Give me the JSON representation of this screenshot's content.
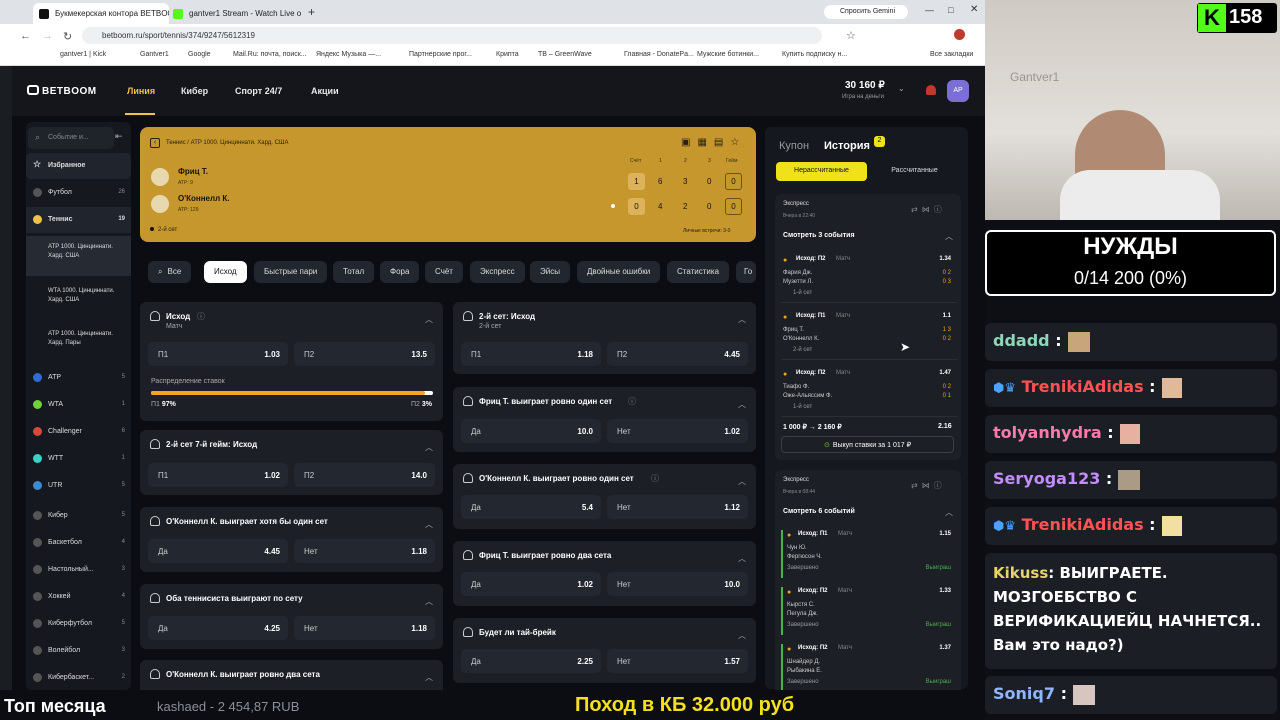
{
  "tabs": [
    {
      "label": "Букмекерская контора BETBOO"
    },
    {
      "label": "gantver1 Stream - Watch Live o"
    }
  ],
  "gemini": "Спросить Gemini",
  "url": "betboom.ru/sport/tennis/374/9247/5612319",
  "bookmarks": [
    "gantver1 | Kick",
    "Gantver1",
    "Google",
    "Mail.Ru: почта, поиск...",
    "Яндекс Музыка —...",
    "Партнерские прог...",
    "Крипта",
    "TB – GreenWave",
    "Главная - DonatePa...",
    "Мужские ботинки...",
    "Купить подписку н...",
    "Все закладки"
  ],
  "header": {
    "logo": "BETBOOM",
    "nav": [
      "Линия",
      "Кибер",
      "Спорт 24/7",
      "Акции"
    ],
    "balance": "30 160 ₽",
    "balance_sub": "Игра на деньги",
    "avatar": "АР"
  },
  "sidebar": {
    "search": "Событие и...",
    "items": [
      {
        "label": "Избранное",
        "count": ""
      },
      {
        "label": "Футбол",
        "count": "26"
      },
      {
        "label": "Теннис",
        "count": "19"
      },
      {
        "label": "ATP 1000. Цинциннати. Хард. США",
        "count": ""
      },
      {
        "label": "WTA 1000. Цинциннати. Хард. США",
        "count": ""
      },
      {
        "label": "ATP 1000. Цинциннати. Хард. Пары",
        "count": ""
      },
      {
        "label": "ATP",
        "count": "5"
      },
      {
        "label": "WTA",
        "count": "1"
      },
      {
        "label": "Challenger",
        "count": "6"
      },
      {
        "label": "WTT",
        "count": "1"
      },
      {
        "label": "UTR",
        "count": "5"
      },
      {
        "label": "Кибер",
        "count": "5"
      },
      {
        "label": "Баскетбол",
        "count": "4"
      },
      {
        "label": "Настольный...",
        "count": "3"
      },
      {
        "label": "Хоккей",
        "count": "4"
      },
      {
        "label": "Киберфутбол",
        "count": "5"
      },
      {
        "label": "Волейбол",
        "count": "3"
      },
      {
        "label": "Кибербаскет...",
        "count": "2"
      }
    ]
  },
  "match": {
    "breadcrumb": "Теннис / ATP 1000. Цинциннати. Хард. США",
    "score_headers": [
      "Счёт",
      "1",
      "2",
      "3",
      "Гейм"
    ],
    "players": [
      {
        "name": "Фриц Т.",
        "rank": "ATP: 9",
        "scores": [
          "1",
          "6",
          "3",
          "0",
          "0"
        ]
      },
      {
        "name": "О'Коннелл К.",
        "rank": "ATP: 129",
        "scores": [
          "0",
          "4",
          "2",
          "0",
          "0"
        ]
      }
    ],
    "status": "2-й сет",
    "h2h": "Личные встречи: 3-0"
  },
  "filters": [
    "Все",
    "Исход",
    "Быстрые пари",
    "Тотал",
    "Фора",
    "Счёт",
    "Экспресс",
    "Эйсы",
    "Двойные ошибки",
    "Статистика",
    "Го"
  ],
  "markets_left": [
    {
      "title": "Исход",
      "sub": "Матч",
      "odds": [
        [
          "П1",
          "1.03"
        ],
        [
          "П2",
          "13.5"
        ]
      ],
      "dist_label": "Распределение ставок",
      "dist": [
        {
          "l": "П1",
          "v": "97%"
        },
        {
          "l": "П2",
          "v": "3%"
        }
      ],
      "dist_fraction": 0.97
    },
    {
      "title": "2-й сет 7-й гейм: Исход",
      "sub": "",
      "odds": [
        [
          "П1",
          "1.02"
        ],
        [
          "П2",
          "14.0"
        ]
      ]
    },
    {
      "title": "О'Коннелл К. выиграет хотя бы один сет",
      "sub": "",
      "odds": [
        [
          "Да",
          "4.45"
        ],
        [
          "Нет",
          "1.18"
        ]
      ]
    },
    {
      "title": "Оба теннисиста выиграют по сету",
      "sub": "",
      "odds": [
        [
          "Да",
          "4.25"
        ],
        [
          "Нет",
          "1.18"
        ]
      ]
    },
    {
      "title": "О'Коннелл К. выиграет ровно два сета",
      "sub": "",
      "odds": []
    }
  ],
  "markets_right": [
    {
      "title": "2-й сет: Исход",
      "sub": "2-й сет",
      "odds": [
        [
          "П1",
          "1.18"
        ],
        [
          "П2",
          "4.45"
        ]
      ]
    },
    {
      "title": "Фриц Т. выиграет ровно один сет",
      "sub": "",
      "odds": [
        [
          "Да",
          "10.0"
        ],
        [
          "Нет",
          "1.02"
        ]
      ]
    },
    {
      "title": "О'Коннелл К. выиграет ровно один сет",
      "sub": "",
      "odds": [
        [
          "Да",
          "5.4"
        ],
        [
          "Нет",
          "1.12"
        ]
      ]
    },
    {
      "title": "Фриц Т. выиграет ровно два сета",
      "sub": "",
      "odds": [
        [
          "Да",
          "1.02"
        ],
        [
          "Нет",
          "10.0"
        ]
      ]
    },
    {
      "title": "Будет ли тай-брейк",
      "sub": "",
      "odds": [
        [
          "Да",
          "2.25"
        ],
        [
          "Нет",
          "1.57"
        ]
      ]
    }
  ],
  "betslip": {
    "tabs": [
      "Купон",
      "История"
    ],
    "history_count": "2",
    "subtabs": [
      "Нерассчитанные",
      "Рассчитанные"
    ],
    "express1": {
      "label": "Экспресс",
      "time": "Вчера в 22:40",
      "events_label": "Смотреть 3 события",
      "bets": [
        {
          "market": "Исход: П2",
          "kind": "Матч",
          "odd": "1.34",
          "p1": "Фария Дж.",
          "p2": "Музетти Л.",
          "status": "1-й сет",
          "s1": "0 2",
          "s2": "0 3"
        },
        {
          "market": "Исход: П1",
          "kind": "Матч",
          "odd": "1.1",
          "p1": "Фриц Т.",
          "p2": "О'Коннелл К.",
          "status": "2-й сет",
          "s1": "1 3",
          "s2": "0 2"
        },
        {
          "market": "Исход: П2",
          "kind": "Матч",
          "odd": "1.47",
          "p1": "Тиафо Ф.",
          "p2": "Оже-Альяссим Ф.",
          "status": "1-й сет",
          "s1": "0 2",
          "s2": "0 1"
        }
      ],
      "stake": "1 000 ₽ → 2 160 ₽",
      "total_odd": "2.16",
      "cashout": "Выкуп ставки за 1 017 ₽"
    },
    "express2": {
      "label": "Экспресс",
      "time": "Вчера в 08:44",
      "events_label": "Смотреть 6 событий",
      "bets": [
        {
          "market": "Исход: П1",
          "kind": "Матч",
          "odd": "1.15",
          "p1": "Чун Ю.",
          "p2": "Фергюсон Ч.",
          "status": "Завершено",
          "result": "Выиграш"
        },
        {
          "market": "Исход: П2",
          "kind": "Матч",
          "odd": "1.33",
          "p1": "Кырстя С.",
          "p2": "Пегула Дж.",
          "status": "Завершено",
          "result": "Выиграш"
        },
        {
          "market": "Исход: П2",
          "kind": "Матч",
          "odd": "1.37",
          "p1": "Шнайдер Д.",
          "p2": "Рыбакина Е.",
          "status": "Завершено",
          "result": "Выиграш"
        }
      ]
    }
  },
  "stream": {
    "viewers": "158",
    "goal_title": "НУЖДЫ",
    "goal_value": "0/14 200 (0%)",
    "top_label": "Топ месяца",
    "top_user": "kashaed - 2 454,87 RUB",
    "banner": "Поход в КБ 32.000 руб",
    "cam_sign": "Gantver1",
    "chat": [
      {
        "user": "ddadd",
        "text": ":",
        "color": "#8fd6b8"
      },
      {
        "user": "TrenikiAdidas",
        "text": ":",
        "color": "#ff5252"
      },
      {
        "user": "tolyanhydra",
        "text": ":",
        "color": "#ff7aa8"
      },
      {
        "user": "Seryoga123",
        "text": ":",
        "color": "#c38cff"
      },
      {
        "user": "TrenikiAdidas",
        "text": ":",
        "color": "#ff5252"
      },
      {
        "user": "Kikuss",
        "text": ": ВЫИГРАЕТЕ. МОЗГОЕБСТВО С ВЕРИФИКАЦИЕЙЦ НАЧНЕТСЯ.. Вам это надо?)",
        "color": "#e6d36b"
      },
      {
        "user": "Soniq7",
        "text": ":",
        "color": "#8fb7ff"
      }
    ]
  }
}
